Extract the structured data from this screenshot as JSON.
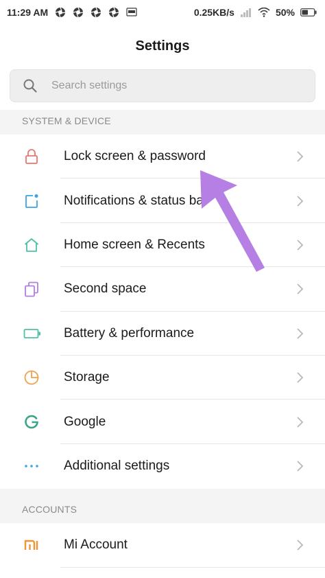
{
  "status_bar": {
    "time": "11:29 AM",
    "net_speed": "0.25KB/s",
    "battery": "50%"
  },
  "header": {
    "title": "Settings"
  },
  "search": {
    "placeholder": "Search settings"
  },
  "sections": [
    {
      "title": "SYSTEM & DEVICE",
      "items": [
        {
          "label": "Lock screen & password",
          "icon": "lock-icon",
          "color": "#e8776e"
        },
        {
          "label": "Notifications & status bar",
          "icon": "notification-icon",
          "color": "#3aa3e3"
        },
        {
          "label": "Home screen & Recents",
          "icon": "home-icon",
          "color": "#4ec0a8"
        },
        {
          "label": "Second space",
          "icon": "second-space-icon",
          "color": "#b07fe0"
        },
        {
          "label": "Battery & performance",
          "icon": "battery-icon",
          "color": "#4ec0a8"
        },
        {
          "label": "Storage",
          "icon": "storage-icon",
          "color": "#f0a04b"
        },
        {
          "label": "Google",
          "icon": "google-icon",
          "color": "#3aa38a"
        },
        {
          "label": "Additional settings",
          "icon": "more-dots-icon",
          "color": "#3aa3e3"
        }
      ]
    },
    {
      "title": "ACCOUNTS",
      "items": [
        {
          "label": "Mi Account",
          "icon": "mi-icon",
          "color": "#f29434"
        }
      ]
    }
  ],
  "colors": {
    "annotation_arrow": "#b57fe3",
    "chevron": "#b8b8b8",
    "divider": "#e6e6e6",
    "section_bg": "#f4f4f4"
  }
}
